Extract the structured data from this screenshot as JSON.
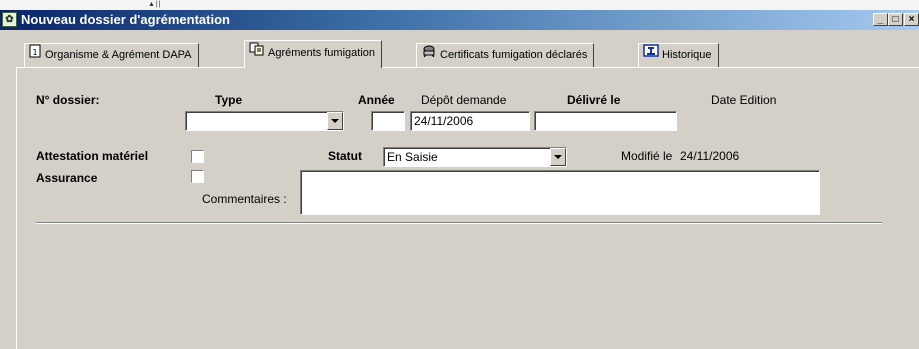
{
  "window": {
    "title": "Nouveau dossier d'agrémentation",
    "controls": {
      "minimize": "_",
      "maximize": "□",
      "close": "×"
    }
  },
  "tabs": [
    {
      "label": "Organisme & Agrément DAPA",
      "icon": "document-icon",
      "active": false
    },
    {
      "label": "Agréments fumigation",
      "icon": "copy-documents-icon",
      "active": true
    },
    {
      "label": "Certificats fumigation déclarés",
      "icon": "certificate-icon",
      "active": false
    },
    {
      "label": "Historique",
      "icon": "history-icon",
      "active": false
    }
  ],
  "form": {
    "dossier_label": "N° dossier:",
    "type_label": "Type",
    "type_value": "",
    "annee_label": "Année",
    "annee_value": "",
    "depot_label": "Dépôt demande",
    "depot_value": "24/11/2006",
    "delivre_label": "Délivré le",
    "delivre_value": "",
    "date_edition_label": "Date Edition",
    "attestation_label": "Attestation matériel",
    "attestation_checked": false,
    "statut_label": "Statut",
    "statut_value": "En Saisie",
    "modifie_label": "Modifié le",
    "modifie_value": "24/11/2006",
    "assurance_label": "Assurance",
    "assurance_checked": false,
    "commentaires_label": "Commentaires :",
    "commentaires_value": ""
  },
  "colors": {
    "face": "#d4d0c8",
    "titlebar_start": "#0a246a",
    "titlebar_end": "#a6caf0"
  }
}
